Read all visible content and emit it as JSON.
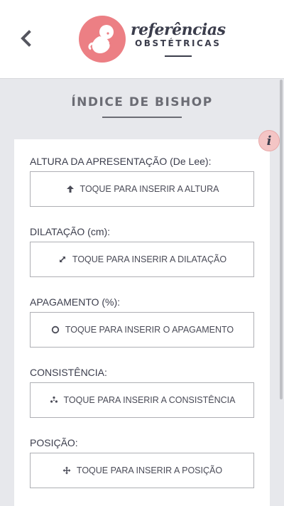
{
  "header": {
    "logo": {
      "line1": "referências",
      "line2": "OBSTÉTRICAS"
    }
  },
  "page": {
    "title": "ÍNDICE DE BISHOP"
  },
  "info_icon": "i",
  "fields": [
    {
      "label": "ALTURA DA APRESENTAÇÃO (De Lee):",
      "button": "TOQUE PARA INSERIR A ALTURA",
      "icon": "arrow-up-icon"
    },
    {
      "label": "DILATAÇÃO (cm):",
      "button": "TOQUE PARA INSERIR A DILATAÇÃO",
      "icon": "expand-icon"
    },
    {
      "label": "APAGAMENTO (%):",
      "button": "TOQUE PARA INSERIR O APAGAMENTO",
      "icon": "circle-icon"
    },
    {
      "label": "CONSISTÊNCIA:",
      "button": "TOQUE PARA INSERIR A CONSISTÊNCIA",
      "icon": "dots-icon"
    },
    {
      "label": "POSIÇÃO:",
      "button": "TOQUE PARA INSERIR A POSIÇÃO",
      "icon": "move-icon"
    }
  ],
  "colors": {
    "background": "#e7e8ec",
    "brand_pink": "#ec7f84",
    "text_dark": "#3b3d4c"
  }
}
